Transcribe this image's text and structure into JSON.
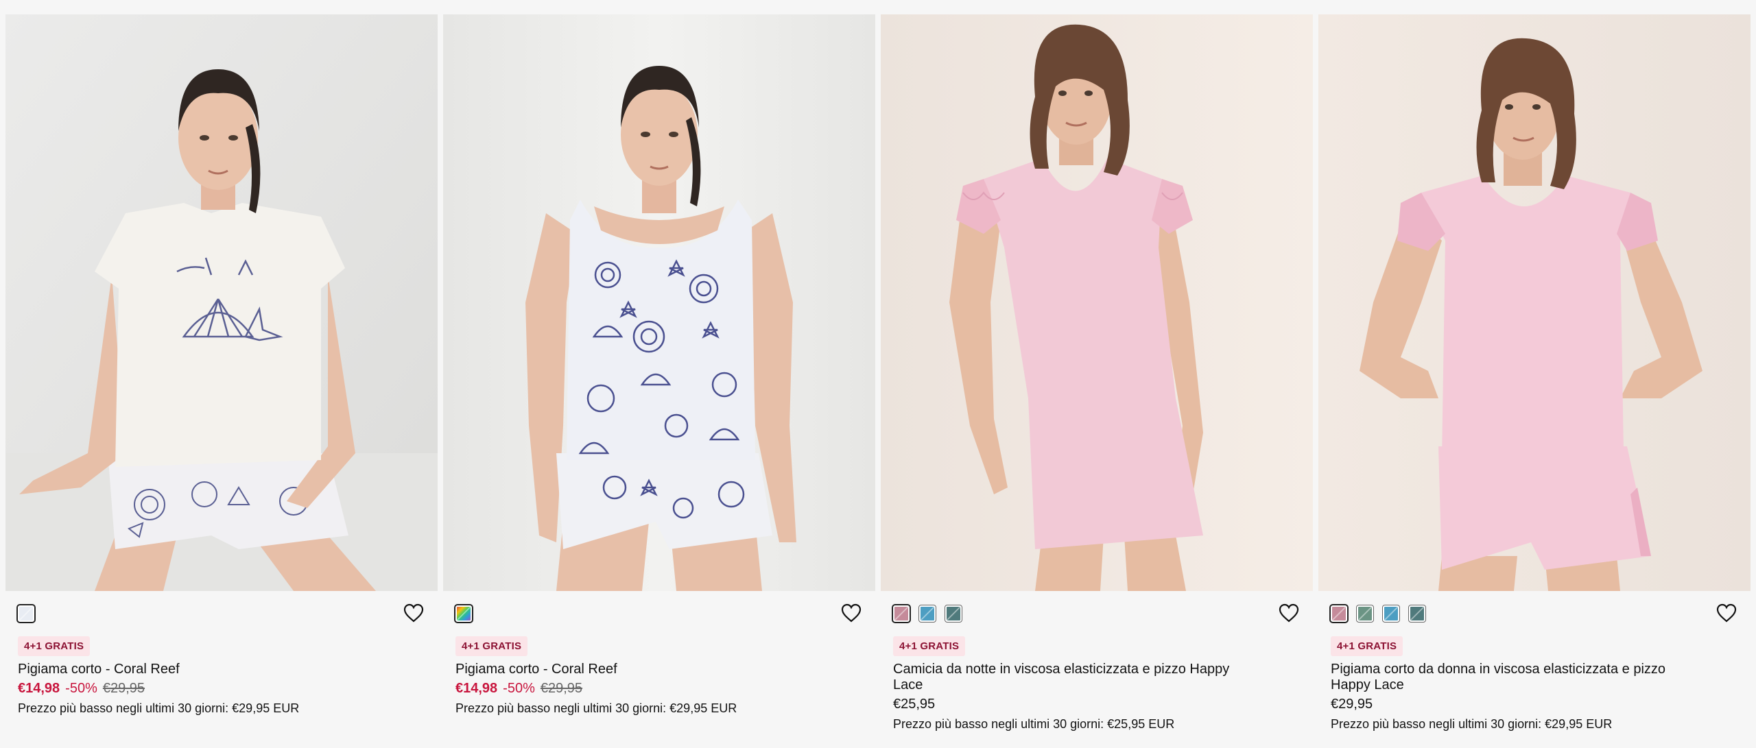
{
  "products": [
    {
      "name": "Pigiama corto - Coral Reef",
      "badge": "4+1 GRATIS",
      "price": "€14,98",
      "discount": "-50%",
      "old_price": "€29,95",
      "lowest_price": "Prezzo più basso negli ultimi 30 giorni: €29,95 EUR",
      "swatches": [
        {
          "name": "white-swatch",
          "color": "#e8ecf3"
        }
      ],
      "top_color": "#f3f1ec",
      "bottom_color": "#f1f0f3",
      "print": "shell",
      "pose": "sitting"
    },
    {
      "name": "Pigiama corto - Coral Reef",
      "badge": "4+1 GRATIS",
      "price": "€14,98",
      "discount": "-50%",
      "old_price": "€29,95",
      "lowest_price": "Prezzo più basso negli ultimi 30 giorni: €29,95 EUR",
      "swatches": [
        {
          "name": "multicolor-swatch",
          "color": "#d7a63c"
        }
      ],
      "top_color": "#eef0f6",
      "bottom_color": "#eef0f6",
      "print": "shell-all",
      "pose": "standing"
    },
    {
      "name": "Camicia da notte in viscosa elasticizzata e pizzo Happy Lace",
      "badge": "4+1 GRATIS",
      "price": "€25,95",
      "discount": "",
      "old_price": "",
      "lowest_price": "Prezzo più basso negli ultimi 30 giorni: €25,95 EUR",
      "swatches": [
        {
          "name": "pink-swatch",
          "color": "#c58b9a"
        },
        {
          "name": "blue-swatch",
          "color": "#4d9ec2"
        },
        {
          "name": "teal-swatch",
          "color": "#4f7a7c"
        }
      ],
      "top_color": "#f2c9d6",
      "bottom_color": "#f2c9d6",
      "print": "plain",
      "pose": "dress"
    },
    {
      "name": "Pigiama corto da donna in viscosa elasticizzata e pizzo Happy Lace",
      "badge": "4+1 GRATIS",
      "price": "€29,95",
      "discount": "",
      "old_price": "",
      "lowest_price": "Prezzo più basso negli ultimi 30 giorni: €29,95 EUR",
      "swatches": [
        {
          "name": "pink-swatch",
          "color": "#c58b9a"
        },
        {
          "name": "green-swatch",
          "color": "#6b9484"
        },
        {
          "name": "blue-swatch",
          "color": "#4d9ec2"
        },
        {
          "name": "teal-swatch",
          "color": "#4f7a7c"
        }
      ],
      "top_color": "#f4cad8",
      "bottom_color": "#f4cad8",
      "print": "plain",
      "pose": "hands-back"
    }
  ]
}
